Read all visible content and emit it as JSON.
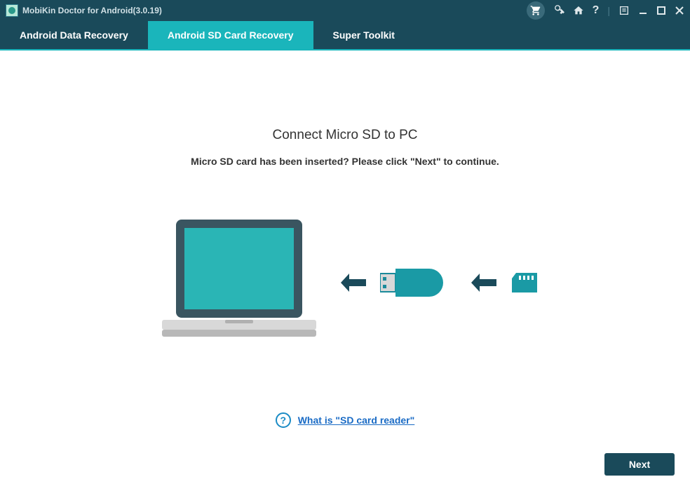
{
  "titleBar": {
    "appTitle": "MobiKin Doctor for Android(3.0.19)"
  },
  "tabs": [
    {
      "label": "Android Data Recovery",
      "active": false
    },
    {
      "label": "Android SD Card Recovery",
      "active": true
    },
    {
      "label": "Super Toolkit",
      "active": false
    }
  ],
  "content": {
    "heading": "Connect Micro SD to PC",
    "subheading": "Micro SD card has been inserted? Please click \"Next\" to continue.",
    "helpLinkText": "What is \"SD card reader\"",
    "nextButton": "Next"
  }
}
